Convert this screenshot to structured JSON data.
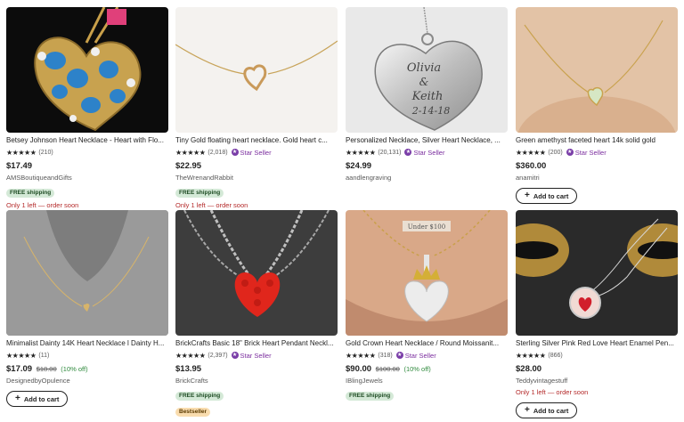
{
  "listings": [
    {
      "title": "Betsey Johnson Heart Necklace - Heart with Flo...",
      "stars": "★★★★★",
      "reviews": "(210)",
      "star_seller": "",
      "price": "$17.49",
      "original_price": "",
      "discount": "",
      "shop": "AMSBoutiqueandGifts",
      "badges": [
        "FREE shipping"
      ],
      "urgency": "Only 1 left — order soon",
      "add_to_cart": ""
    },
    {
      "title": "Tiny Gold floating heart necklace. Gold heart c...",
      "stars": "★★★★★",
      "reviews": "(2,018)",
      "star_seller": "Star Seller",
      "price": "$22.95",
      "original_price": "",
      "discount": "",
      "shop": "TheWrenandRabbit",
      "badges": [
        "FREE shipping"
      ],
      "urgency": "Only 1 left — order soon",
      "add_to_cart": ""
    },
    {
      "title": "Personalized Necklace, Silver Heart Necklace, ...",
      "stars": "★★★★★",
      "reviews": "(20,131)",
      "star_seller": "Star Seller",
      "price": "$24.99",
      "original_price": "",
      "discount": "",
      "shop": "aandlengraving",
      "badges": [],
      "urgency": "",
      "add_to_cart": "",
      "engraving": [
        "Olivia",
        "&",
        "Keith",
        "2-14-18"
      ]
    },
    {
      "title": "Green amethyst faceted heart 14k solid gold",
      "stars": "★★★★★",
      "reviews": "(200)",
      "star_seller": "Star Seller",
      "price": "$360.00",
      "original_price": "",
      "discount": "",
      "shop": "anamitri",
      "badges": [],
      "urgency": "",
      "add_to_cart": "Add to cart"
    },
    {
      "title": "Minimalist Dainty 14K Heart Necklace l Dainty H...",
      "stars": "★★★★★",
      "reviews": "(11)",
      "star_seller": "",
      "price": "$17.09",
      "original_price": "$18.00",
      "discount": "(10% off)",
      "shop": "DesignedbyOpulence",
      "badges": [],
      "urgency": "",
      "add_to_cart": "Add to cart"
    },
    {
      "title": "BrickCrafts Basic 18\" Brick Heart Pendant Neckl...",
      "stars": "★★★★★",
      "reviews": "(2,397)",
      "star_seller": "Star Seller",
      "price": "$13.95",
      "original_price": "",
      "discount": "",
      "shop": "BrickCrafts",
      "badges": [
        "FREE shipping",
        "Bestseller"
      ],
      "urgency": "",
      "add_to_cart": ""
    },
    {
      "title": "Gold Crown Heart Necklace / Round Moissanit...",
      "stars": "★★★★★",
      "reviews": "(318)",
      "star_seller": "Star Seller",
      "price": "$90.00",
      "original_price": "$100.00",
      "discount": "(10% off)",
      "shop": "IBlingJewels",
      "badges": [
        "FREE shipping"
      ],
      "urgency": "",
      "add_to_cart": "",
      "image_label": "Under $100"
    },
    {
      "title": "Sterling Silver Pink Red Love Heart Enamel Pen...",
      "stars": "★★★★★",
      "reviews": "(866)",
      "star_seller": "",
      "price": "$28.00",
      "original_price": "",
      "discount": "",
      "shop": "Teddyvintagestuff",
      "badges": [],
      "urgency": "Only 1 left — order soon",
      "add_to_cart": "Add to cart"
    }
  ],
  "icons": {
    "star_seller_icon": "star-badge",
    "add_icon": "plus"
  },
  "colors": {
    "star_seller": "#7a2c9e",
    "free_shipping_bg": "#d4e9d7",
    "bestseller_bg": "#f9dcae",
    "urgency": "#b42a2a",
    "discount": "#2f8a3d"
  }
}
